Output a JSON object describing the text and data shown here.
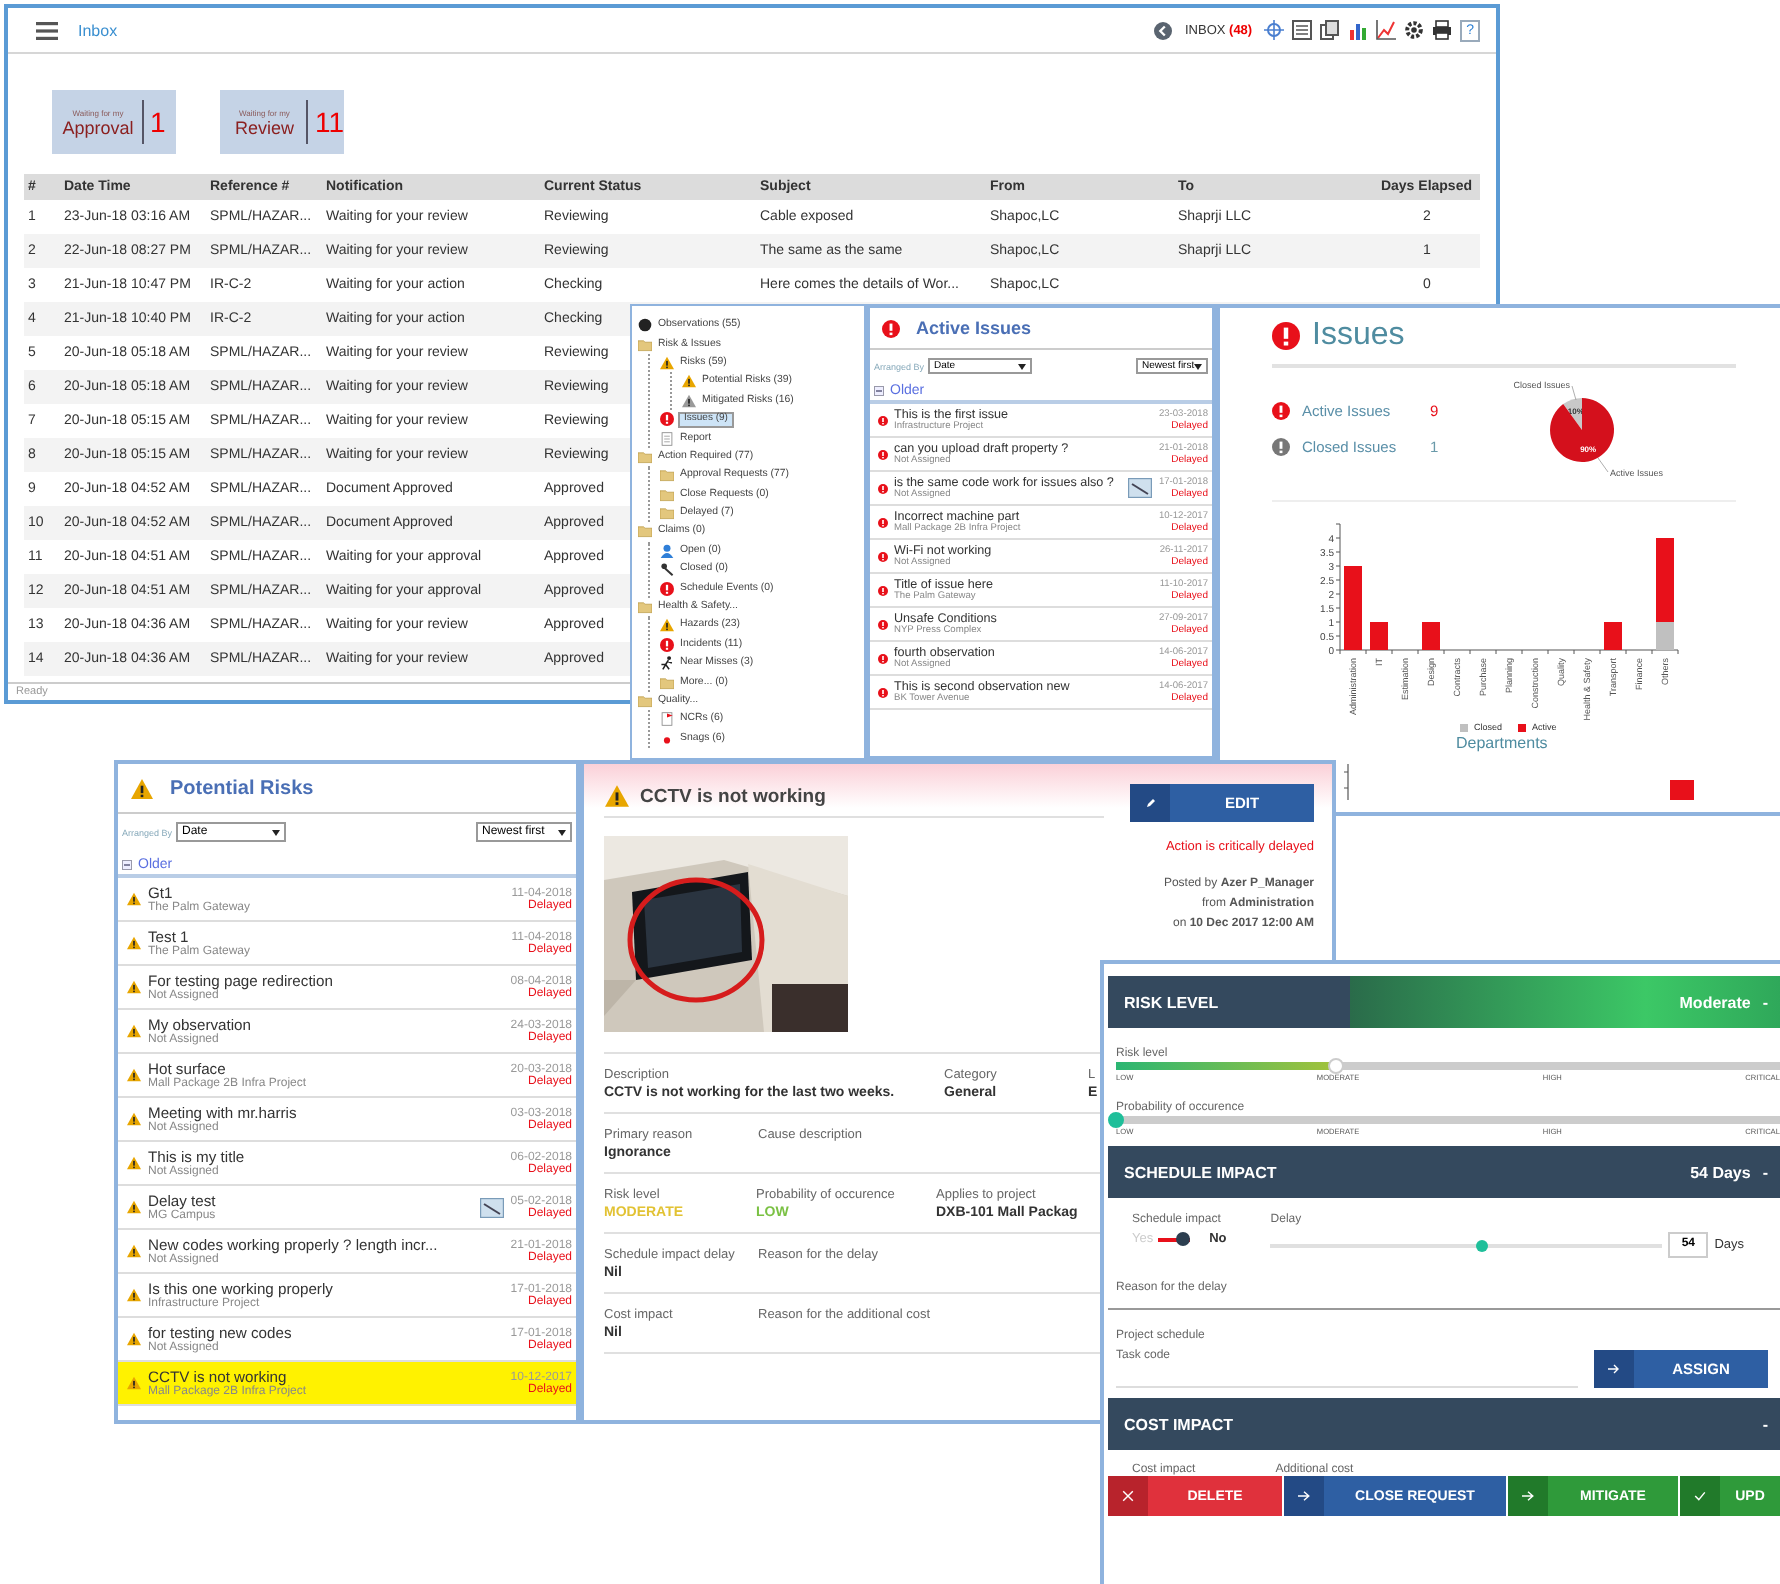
{
  "inbox": {
    "title": "Inbox",
    "counter_label": "INBOX",
    "counter": "(48)",
    "help": "?",
    "tiles": [
      {
        "caption": "Waiting for my",
        "label": "Approval",
        "count": "1"
      },
      {
        "caption": "Waiting for my",
        "label": "Review",
        "count": "11"
      }
    ],
    "columns": [
      "#",
      "Date Time",
      "Reference #",
      "Notification",
      "Current Status",
      "Subject",
      "From",
      "To",
      "Days Elapsed"
    ],
    "rows": [
      {
        "n": "1",
        "date": "23-Jun-18 03:16 AM",
        "ref": "SPML/HAZAR...",
        "note": "Waiting for your review",
        "status": "Reviewing",
        "subject": "Cable exposed",
        "from": "Shapoc,LC",
        "to": "Shaprji LLC",
        "days": "2"
      },
      {
        "n": "2",
        "date": "22-Jun-18 08:27 PM",
        "ref": "SPML/HAZAR...",
        "note": "Waiting for your review",
        "status": "Reviewing",
        "subject": "The same as the same",
        "from": "Shapoc,LC",
        "to": "Shaprji LLC",
        "days": "1"
      },
      {
        "n": "3",
        "date": "21-Jun-18 10:47 PM",
        "ref": "IR-C-2",
        "note": "Waiting for your action",
        "status": "Checking",
        "subject": "Here comes the details of Wor...",
        "from": "Shapoc,LC",
        "days": "0"
      },
      {
        "n": "4",
        "date": "21-Jun-18 10:40 PM",
        "ref": "IR-C-2",
        "note": "Waiting for your action",
        "status": "Checking"
      },
      {
        "n": "5",
        "date": "20-Jun-18 05:18 AM",
        "ref": "SPML/HAZAR...",
        "note": "Waiting for your review",
        "status": "Reviewing"
      },
      {
        "n": "6",
        "date": "20-Jun-18 05:18 AM",
        "ref": "SPML/HAZAR...",
        "note": "Waiting for your review",
        "status": "Reviewing"
      },
      {
        "n": "7",
        "date": "20-Jun-18 05:15 AM",
        "ref": "SPML/HAZAR...",
        "note": "Waiting for your review",
        "status": "Reviewing"
      },
      {
        "n": "8",
        "date": "20-Jun-18 05:15 AM",
        "ref": "SPML/HAZAR...",
        "note": "Waiting for your review",
        "status": "Reviewing"
      },
      {
        "n": "9",
        "date": "20-Jun-18 04:52 AM",
        "ref": "SPML/HAZAR...",
        "note": "Document Approved",
        "status": "Approved"
      },
      {
        "n": "10",
        "date": "20-Jun-18 04:52 AM",
        "ref": "SPML/HAZAR...",
        "note": "Document Approved",
        "status": "Approved"
      },
      {
        "n": "11",
        "date": "20-Jun-18 04:51 AM",
        "ref": "SPML/HAZAR...",
        "note": "Waiting for your approval",
        "status": "Approved"
      },
      {
        "n": "12",
        "date": "20-Jun-18 04:51 AM",
        "ref": "SPML/HAZAR...",
        "note": "Waiting for your approval",
        "status": "Approved"
      },
      {
        "n": "13",
        "date": "20-Jun-18 04:36 AM",
        "ref": "SPML/HAZAR...",
        "note": "Waiting for your review",
        "status": "Approved"
      },
      {
        "n": "14",
        "date": "20-Jun-18 04:36 AM",
        "ref": "SPML/HAZAR...",
        "note": "Waiting for your review",
        "status": "Approved"
      }
    ],
    "status_bar": "Ready"
  },
  "tree": {
    "items": [
      {
        "label": "Observations (55)",
        "kind": "root",
        "selected": false
      },
      {
        "label": "Risk & Issues",
        "kind": "folder",
        "selected": false,
        "children": [
          {
            "label": "Risks (59)",
            "kind": "warning",
            "selected": false,
            "children": [
              {
                "label": "Potential Risks (39)",
                "kind": "warning",
                "selected": false
              },
              {
                "label": "Mitigated Risks (16)",
                "kind": "mitigated",
                "selected": false
              }
            ]
          },
          {
            "label": "Issues (9)",
            "kind": "alert",
            "selected": true
          },
          {
            "label": "Report",
            "kind": "report",
            "selected": false
          }
        ]
      },
      {
        "label": "Action Required (77)",
        "kind": "folder",
        "selected": false,
        "children": [
          {
            "label": "Approval Requests (77)",
            "kind": "folder",
            "selected": false
          },
          {
            "label": "Close Requests (0)",
            "kind": "folder",
            "selected": false
          },
          {
            "label": "Delayed (7)",
            "kind": "folder",
            "selected": false
          }
        ]
      },
      {
        "label": "Claims (0)",
        "kind": "folder",
        "selected": false,
        "children": [
          {
            "label": "Open (0)",
            "kind": "person",
            "selected": false
          },
          {
            "label": "Closed (0)",
            "kind": "tool",
            "selected": false
          },
          {
            "label": "Schedule Events (0)",
            "kind": "alert",
            "selected": false
          }
        ]
      },
      {
        "label": "Health & Safety...",
        "kind": "folder",
        "selected": false,
        "children": [
          {
            "label": "Hazards (23)",
            "kind": "warning",
            "selected": false
          },
          {
            "label": "Incidents (11)",
            "kind": "alert",
            "selected": false
          },
          {
            "label": "Near Misses (3)",
            "kind": "runner",
            "selected": false
          },
          {
            "label": "More... (0)",
            "kind": "folder",
            "selected": false
          }
        ]
      },
      {
        "label": "Quality...",
        "kind": "folder",
        "selected": false,
        "children": [
          {
            "label": "NCRs (6)",
            "kind": "flag",
            "selected": false
          },
          {
            "label": "Snags (6)",
            "kind": "dot",
            "selected": false
          }
        ]
      }
    ]
  },
  "active_issues": {
    "title": "Active Issues",
    "arranged_label": "Arranged By",
    "sort_field": "Date",
    "sort_order": "Newest first",
    "group": "Older",
    "items": [
      {
        "title": "This is the first issue",
        "project": "Infrastructure Project",
        "date": "23-03-2018",
        "status": "Delayed",
        "attachment": false
      },
      {
        "title": "can you upload draft property ?",
        "project": "Not Assigned",
        "date": "21-01-2018",
        "status": "Delayed",
        "attachment": false
      },
      {
        "title": "is the same code work for issues also ?",
        "project": "Not Assigned",
        "date": "17-01-2018",
        "status": "Delayed",
        "attachment": true
      },
      {
        "title": "Incorrect machine part",
        "project": "Mall Package 2B Infra Project",
        "date": "10-12-2017",
        "status": "Delayed",
        "attachment": false
      },
      {
        "title": "Wi-Fi not working",
        "project": "Not Assigned",
        "date": "26-11-2017",
        "status": "Delayed",
        "attachment": false
      },
      {
        "title": "Title of issue here",
        "project": "The Palm Gateway",
        "date": "11-10-2017",
        "status": "Delayed",
        "attachment": false
      },
      {
        "title": "Unsafe Conditions",
        "project": "NYP Press Complex",
        "date": "27-09-2017",
        "status": "Delayed",
        "attachment": false
      },
      {
        "title": "fourth observation",
        "project": "Not Assigned",
        "date": "14-06-2017",
        "status": "Delayed",
        "attachment": false
      },
      {
        "title": "This is second observation new",
        "project": "BK Tower Avenue",
        "date": "14-06-2017",
        "status": "Delayed",
        "attachment": false
      }
    ]
  },
  "issues": {
    "title": "Issues",
    "stats": [
      {
        "label": "Active Issues",
        "count": "9",
        "kind": "active"
      },
      {
        "label": "Closed Issues",
        "count": "1",
        "kind": "closed"
      }
    ],
    "pie": {
      "chart_data": {
        "type": "pie",
        "categories": [
          "Closed Issues",
          "Active Issues"
        ],
        "values": [
          10,
          90
        ],
        "value_labels": [
          "10%",
          "90%"
        ]
      }
    },
    "departments_chart": {
      "chart_data": {
        "type": "bar",
        "xlabel": "Departments",
        "stacked": true,
        "legend": "bottom",
        "categories": [
          "Administration",
          "IT",
          "Estimation",
          "Design",
          "Contracts",
          "Purchase",
          "Planning",
          "Construction",
          "Quality",
          "Health & Safety",
          "Transport",
          "Finance",
          "Others"
        ],
        "series": [
          {
            "name": "Closed",
            "color": "#c0c0c0",
            "values": [
              0,
              0,
              0,
              0,
              0,
              0,
              0,
              0,
              0,
              0,
              0,
              0,
              1
            ]
          },
          {
            "name": "Active",
            "color": "#e8101a",
            "values": [
              3,
              1,
              0,
              1,
              0,
              0,
              0,
              0,
              0,
              0,
              1,
              0,
              3
            ]
          }
        ],
        "ylim": [
          0,
          4.5
        ],
        "yticks": [
          0,
          0.5,
          1,
          1.5,
          2,
          2.5,
          3,
          3.5,
          4
        ]
      }
    }
  },
  "potential_risks": {
    "title": "Potential Risks",
    "arranged_label": "Arranged By",
    "sort_field": "Date",
    "sort_order": "Newest first",
    "group": "Older",
    "items": [
      {
        "title": "Gt1",
        "project": "The Palm Gateway",
        "date": "11-04-2018",
        "status": "Delayed",
        "attachment": false,
        "selected": false
      },
      {
        "title": "Test 1",
        "project": "The Palm Gateway",
        "date": "11-04-2018",
        "status": "Delayed",
        "attachment": false,
        "selected": false
      },
      {
        "title": "For testing page redirection",
        "project": "Not Assigned",
        "date": "08-04-2018",
        "status": "Delayed",
        "attachment": false,
        "selected": false
      },
      {
        "title": "My observation",
        "project": "Not Assigned",
        "date": "24-03-2018",
        "status": "Delayed",
        "attachment": false,
        "selected": false
      },
      {
        "title": "Hot surface",
        "project": "Mall Package 2B Infra Project",
        "date": "20-03-2018",
        "status": "Delayed",
        "attachment": false,
        "selected": false
      },
      {
        "title": "Meeting with mr.harris",
        "project": "Not Assigned",
        "date": "03-03-2018",
        "status": "Delayed",
        "attachment": false,
        "selected": false
      },
      {
        "title": "This is my title",
        "project": "Not Assigned",
        "date": "06-02-2018",
        "status": "Delayed",
        "attachment": false,
        "selected": false
      },
      {
        "title": "Delay test",
        "project": "MG Campus",
        "date": "05-02-2018",
        "status": "Delayed",
        "attachment": true,
        "selected": false
      },
      {
        "title": "New codes working properly ? length incr...",
        "project": "Not Assigned",
        "date": "21-01-2018",
        "status": "Delayed",
        "attachment": false,
        "selected": false
      },
      {
        "title": "Is this one working properly",
        "project": "Infrastructure Project",
        "date": "17-01-2018",
        "status": "Delayed",
        "attachment": false,
        "selected": false
      },
      {
        "title": "for testing new codes",
        "project": "Not Assigned",
        "date": "17-01-2018",
        "status": "Delayed",
        "attachment": false,
        "selected": false
      },
      {
        "title": "CCTV is not working",
        "project": "Mall Package 2B Infra Project",
        "date": "10-12-2017",
        "status": "Delayed",
        "attachment": false,
        "selected": true
      }
    ]
  },
  "detail": {
    "title": "CCTV is not working",
    "edit": "EDIT",
    "alert": "Action is critically delayed",
    "posted": [
      "Posted by **Azer P_Manager**",
      "from **Administration**",
      "on **10 Dec 2017 12:00 AM**"
    ],
    "fields": [
      [
        {
          "label": "Description",
          "value": "CCTV is not working for the last two weeks."
        },
        {
          "label": "Category",
          "value": "General"
        },
        {
          "label": "L",
          "value": "E"
        }
      ],
      [
        {
          "label": "Primary reason",
          "value": "Ignorance"
        },
        {
          "label": "Cause description"
        }
      ],
      [
        {
          "label": "Risk level",
          "value": "MODERATE",
          "color": "#e2c233"
        },
        {
          "label": "Probability of occurence",
          "value": "LOW",
          "color": "#7ac143"
        },
        {
          "label": "Applies to project",
          "value": "DXB-101 Mall Packag"
        }
      ],
      [
        {
          "label": "Schedule impact delay",
          "value": "Nil"
        },
        {
          "label": "Reason for the delay"
        }
      ],
      [
        {
          "label": "Cost impact",
          "value": "Nil"
        },
        {
          "label": "Reason for the additional cost"
        }
      ]
    ]
  },
  "risk_panel": {
    "risk_level": {
      "title": "RISK LEVEL",
      "value": "Moderate",
      "collapse": "-",
      "sliders": [
        {
          "label": "Risk level",
          "level": 0.33,
          "ticks": [
            "LOW",
            "MODERATE",
            "HIGH",
            "CRITICAL"
          ]
        },
        {
          "label": "Probability of occurence",
          "level": 0,
          "ticks": [
            "LOW",
            "MODERATE",
            "HIGH",
            "CRITICAL"
          ]
        }
      ]
    },
    "schedule": {
      "title": "SCHEDULE IMPACT",
      "value": "54 Days",
      "collapse": "-",
      "impact_label": "Schedule impact",
      "options": [
        {
          "label": "Yes",
          "selected": false
        },
        {
          "label": "No",
          "selected": true
        }
      ],
      "delay_label": "Delay",
      "delay": {
        "level": 0.54,
        "value": "54",
        "unit": "Days"
      },
      "reason_label": "Reason for the delay",
      "project_schedule": "Project schedule",
      "task_code": "Task code",
      "assign": "ASSIGN"
    },
    "cost": {
      "title": "COST IMPACT",
      "collapse": "-",
      "labels": [
        "Cost impact",
        "Additional cost"
      ]
    },
    "actions": [
      {
        "label": "DELETE",
        "kind": "delete"
      },
      {
        "label": "CLOSE REQUEST",
        "kind": "forward"
      },
      {
        "label": "MITIGATE",
        "kind": "confirm"
      },
      {
        "label": "UPD",
        "kind": "done"
      }
    ]
  }
}
